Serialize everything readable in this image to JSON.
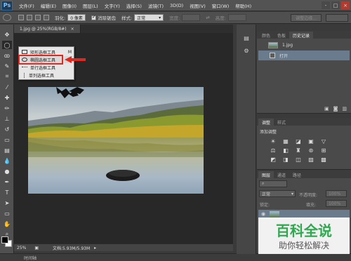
{
  "app": {
    "logo": "Ps"
  },
  "menu": [
    "文件(F)",
    "编辑(E)",
    "图像(I)",
    "图层(L)",
    "文字(Y)",
    "选择(S)",
    "滤镜(T)",
    "3D(D)",
    "视图(V)",
    "窗口(W)",
    "帮助(H)"
  ],
  "window_controls": {
    "minimize": "-",
    "restore": "□",
    "close": "×"
  },
  "options": {
    "feather_label": "羽化:",
    "feather_value": "0 像素",
    "antialias_label": "消除锯齿",
    "style_label": "样式:",
    "style_value": "正常",
    "width_label": "宽度:",
    "height_label": "高度:",
    "refine_edge": "调整边缘..."
  },
  "document": {
    "tab_title": "1.jpg @ 25%(RGB/8#)",
    "tab_close": "×"
  },
  "flyout": {
    "items": [
      {
        "label": "矩形选框工具",
        "key": "M"
      },
      {
        "label": "椭圆选框工具",
        "key": "M"
      },
      {
        "label": "单行选框工具",
        "key": ""
      },
      {
        "label": "单列选框工具",
        "key": ""
      }
    ]
  },
  "status": {
    "zoom": "25%",
    "doc_info": "文档:5.93M/5.93M"
  },
  "timeline": {
    "label": "时间轴"
  },
  "history_panel": {
    "tabs": [
      "颜色",
      "色板",
      "历史记录"
    ],
    "rows": [
      {
        "label": "1.jpg"
      },
      {
        "label": "打开"
      }
    ]
  },
  "adjust_panel": {
    "tabs": [
      "调整",
      "样式"
    ],
    "title": "添加调整",
    "icons": [
      "☀",
      "▦",
      "◪",
      "▣",
      "▽",
      "⚖",
      "◧",
      "♜",
      "⊛",
      "⊞",
      "◩",
      "◨",
      "◫",
      "▨",
      "▩"
    ]
  },
  "layers_panel": {
    "tabs": [
      "图层",
      "通道",
      "路径"
    ],
    "blend": "正常",
    "opacity_label": "不透明度:",
    "opacity_value": "100%",
    "lock_label": "锁定:",
    "fill_label": "填充:",
    "fill_value": "100%"
  },
  "watermark": {
    "title": "百科全说",
    "subtitle": "助你轻松解决"
  },
  "colors": {
    "highlight": "#e0281e",
    "watermark_green": "#2fa84f"
  }
}
